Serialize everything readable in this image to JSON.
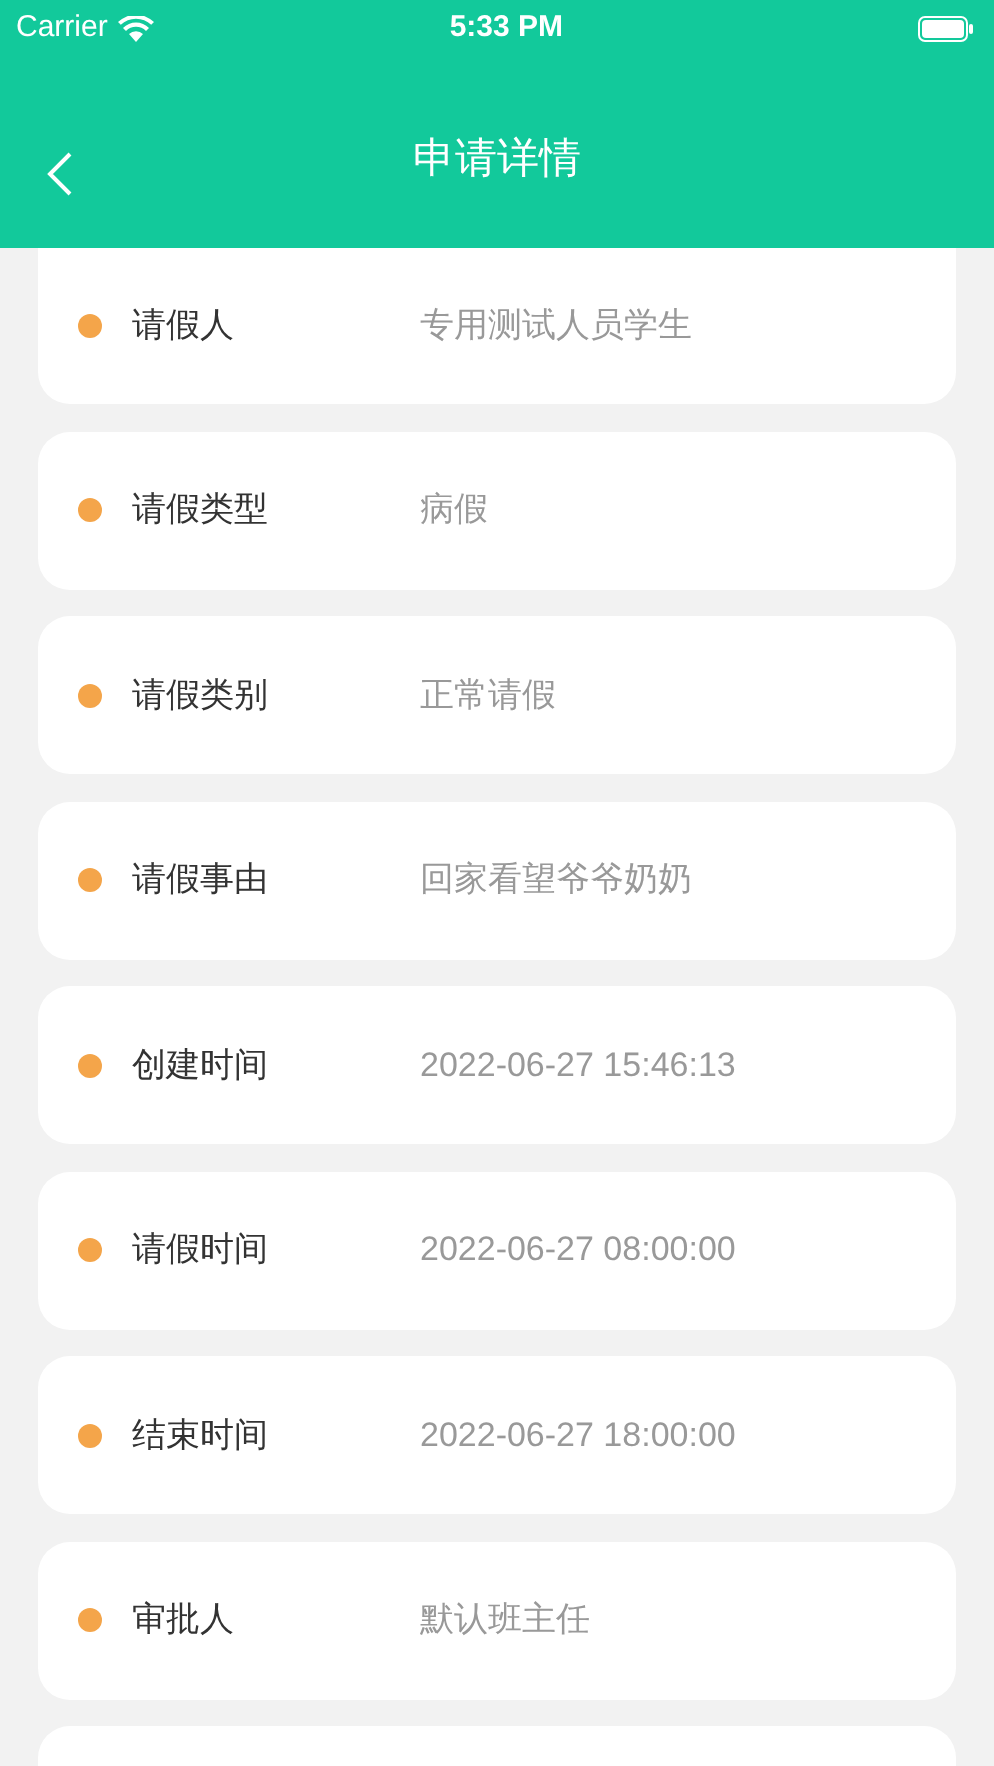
{
  "status_bar": {
    "carrier": "Carrier",
    "time": "5:33 PM"
  },
  "header": {
    "title": "申请详情"
  },
  "fields": [
    {
      "label": "请假人",
      "value": "专用测试人员学生"
    },
    {
      "label": "请假类型",
      "value": "病假"
    },
    {
      "label": "请假类别",
      "value": "正常请假"
    },
    {
      "label": "请假事由",
      "value": "回家看望爷爷奶奶"
    },
    {
      "label": "创建时间",
      "value": "2022-06-27 15:46:13"
    },
    {
      "label": "请假时间",
      "value": "2022-06-27 08:00:00"
    },
    {
      "label": "结束时间",
      "value": "2022-06-27 18:00:00"
    },
    {
      "label": "审批人",
      "value": "默认班主任"
    }
  ]
}
